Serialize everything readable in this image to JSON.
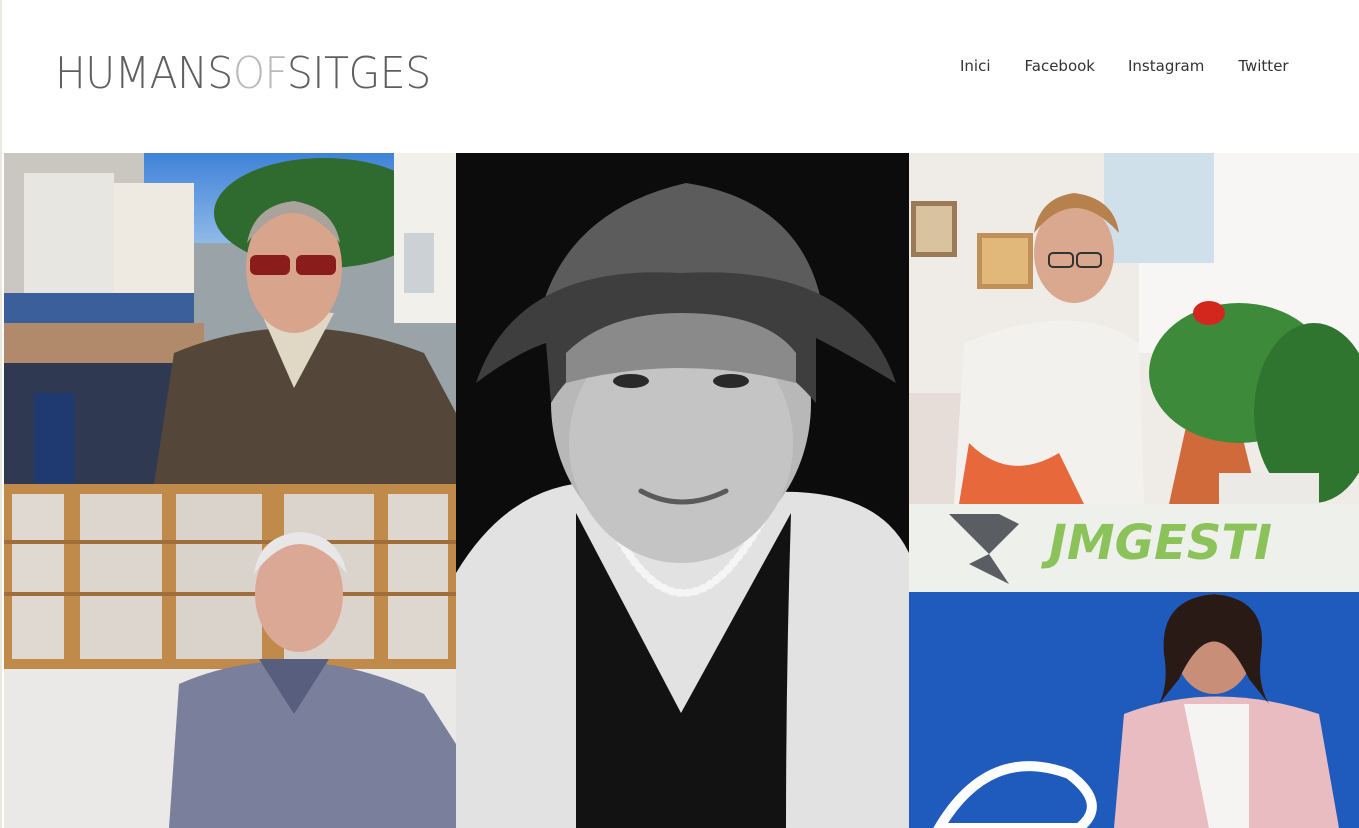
{
  "site": {
    "logo_part1": "HUMANS",
    "logo_part2": "OF",
    "logo_part3": "SITGES"
  },
  "nav": {
    "items": [
      {
        "label": "Inici"
      },
      {
        "label": "Facebook"
      },
      {
        "label": "Instagram"
      },
      {
        "label": "Twitter"
      }
    ]
  },
  "gallery": {
    "photos": [
      {
        "subject": "portrait-elderly-man-sunglasses-sweater"
      },
      {
        "subject": "portrait-woman-bucket-hat-pearls-bw"
      },
      {
        "subject": "portrait-elderly-woman-plants"
      },
      {
        "subject": "portrait-man-grey-sweater-lab"
      },
      {
        "subject": "portrait-woman-pink-cardigan-sign"
      }
    ],
    "sign_text": "JMGESTI"
  }
}
